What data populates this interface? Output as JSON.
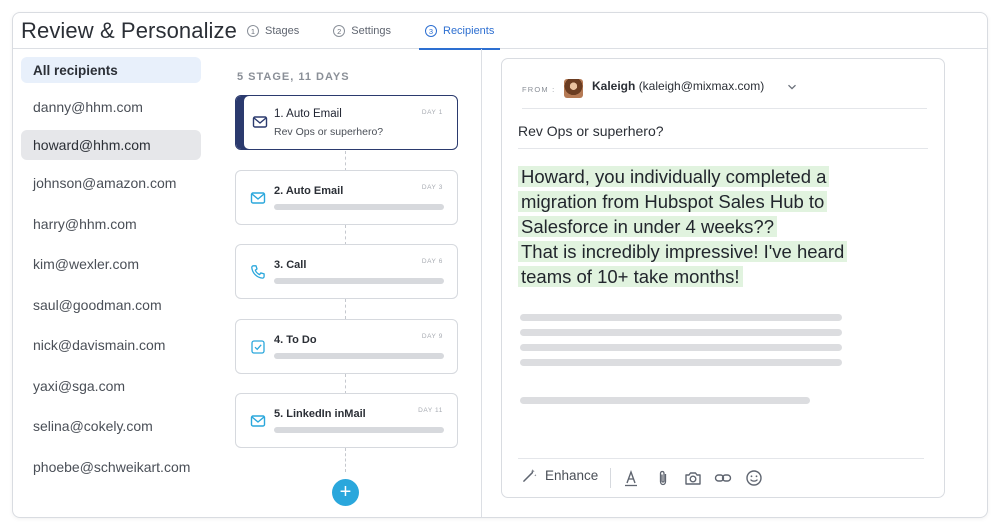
{
  "header": {
    "title": "Review & Personalize",
    "tabs": [
      {
        "num": "1",
        "label": "Stages"
      },
      {
        "num": "2",
        "label": "Settings"
      },
      {
        "num": "3",
        "label": "Recipients"
      }
    ]
  },
  "recipients": {
    "all_label": "All recipients",
    "items": [
      "danny@hhm.com",
      "howard@hhm.com",
      "johnson@amazon.com",
      "harry@hhm.com",
      "kim@wexler.com",
      "saul@goodman.com",
      "nick@davismain.com",
      "yaxi@sga.com",
      "selina@cokely.com",
      "phoebe@schweikart.com"
    ]
  },
  "stages": {
    "summary": "5 STAGE, 11 DAYS",
    "items": [
      {
        "title": "1. Auto Email",
        "subtitle": "Rev Ops or superhero?",
        "day": "DAY 1",
        "icon": "mail-icon"
      },
      {
        "title": "2. Auto Email",
        "day": "DAY 3",
        "icon": "mail-icon"
      },
      {
        "title": "3. Call",
        "day": "DAY 6",
        "icon": "phone-icon"
      },
      {
        "title": "4. To Do",
        "day": "DAY 9",
        "icon": "checkbox-icon"
      },
      {
        "title": "5. LinkedIn inMail",
        "day": "DAY 11",
        "icon": "mail-icon"
      }
    ],
    "add_label": "+"
  },
  "email": {
    "from_label": "FROM :",
    "sender_name": "Kaleigh",
    "sender_email": "(kaleigh@mixmax.com)",
    "subject": "Rev Ops or superhero?",
    "body_lines": [
      "Howard, you individually completed a",
      "migration from Hubspot Sales Hub to",
      "Salesforce in under 4 weeks??",
      "That is incredibly impressive! I've heard",
      "teams of 10+ take months!"
    ],
    "enhance_label": "Enhance"
  },
  "colors": {
    "accent": "#2d6fd1",
    "active_stage": "#2b3a6e",
    "add_button": "#2aa7dc",
    "highlight": "#e1f3df",
    "stage_icon": "#2aa7dc"
  }
}
